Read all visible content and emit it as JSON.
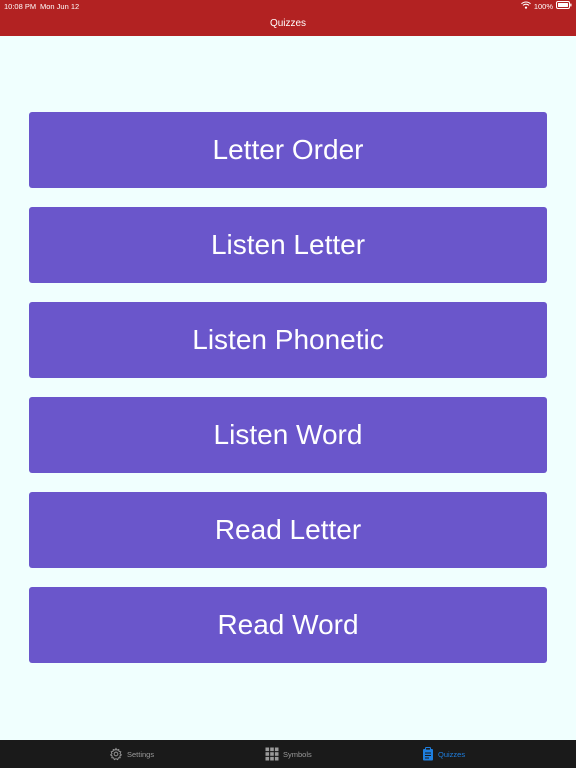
{
  "status_bar": {
    "time": "10:08 PM",
    "date": "Mon Jun 12",
    "battery": "100%",
    "wifi_icon": "wifi-icon",
    "battery_icon": "battery-icon"
  },
  "nav": {
    "title": "Quizzes"
  },
  "quizzes": [
    {
      "label": "Letter Order"
    },
    {
      "label": "Listen Letter"
    },
    {
      "label": "Listen Phonetic"
    },
    {
      "label": "Listen Word"
    },
    {
      "label": "Read Letter"
    },
    {
      "label": "Read Word"
    }
  ],
  "tabs": [
    {
      "label": "Settings",
      "icon": "gear-icon",
      "active": false
    },
    {
      "label": "Symbols",
      "icon": "grid-icon",
      "active": false
    },
    {
      "label": "Quizzes",
      "icon": "clipboard-icon",
      "active": true
    }
  ],
  "colors": {
    "header": "#B22222",
    "background": "#F0FFFE",
    "button": "#6A56CB",
    "tab_bar": "#1A1A1A",
    "tab_active": "#1E7FE0",
    "tab_inactive": "#9A9A9A"
  }
}
